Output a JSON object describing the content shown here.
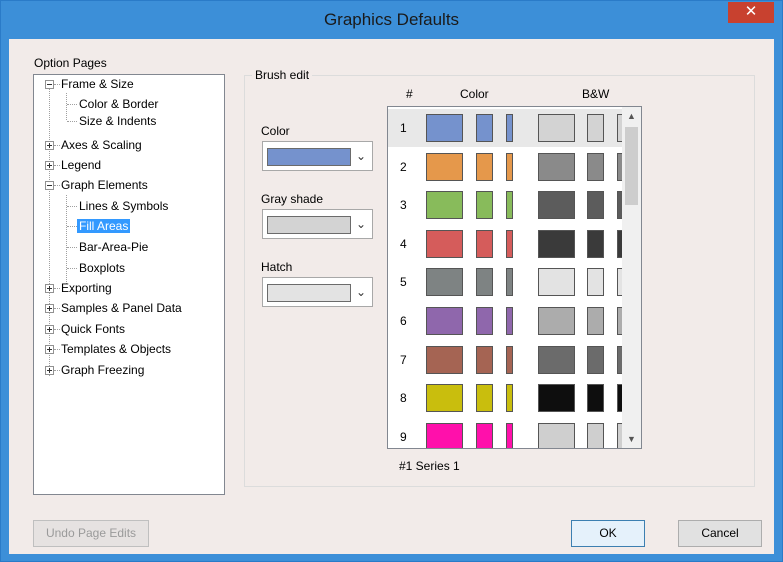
{
  "window": {
    "title": "Graphics Defaults",
    "close_glyph": "✕"
  },
  "option_pages": {
    "label": "Option Pages",
    "items": [
      {
        "label": "Frame & Size"
      },
      {
        "label": "Color & Border"
      },
      {
        "label": "Size & Indents"
      },
      {
        "label": "Axes & Scaling"
      },
      {
        "label": "Legend"
      },
      {
        "label": "Graph Elements"
      },
      {
        "label": "Lines & Symbols"
      },
      {
        "label": "Fill Areas",
        "selected": true
      },
      {
        "label": "Bar-Area-Pie"
      },
      {
        "label": "Boxplots"
      },
      {
        "label": "Exporting"
      },
      {
        "label": "Samples & Panel Data"
      },
      {
        "label": "Quick Fonts"
      },
      {
        "label": "Templates & Objects"
      },
      {
        "label": "Graph Freezing"
      }
    ]
  },
  "brush_edit": {
    "title": "Brush edit",
    "color_label": "Color",
    "color_value": "#7592cd",
    "gray_label": "Gray shade",
    "gray_value": "#d3d3d3",
    "hatch_label": "Hatch",
    "hatch_value": "#e3e3e3",
    "dropdown_glyph": "⌄"
  },
  "brush_list": {
    "col_num": "#",
    "col_color": "Color",
    "col_bw": "B&W",
    "rows": [
      {
        "num": "1",
        "color": "#7592cd",
        "gray": "#d3d3d3",
        "selected": true
      },
      {
        "num": "2",
        "color": "#e5984b",
        "gray": "#8a8a8a"
      },
      {
        "num": "3",
        "color": "#88bb5b",
        "gray": "#5c5c5c"
      },
      {
        "num": "4",
        "color": "#d55c5b",
        "gray": "#3a3a3a"
      },
      {
        "num": "5",
        "color": "#7e8383",
        "gray": "#e3e3e3"
      },
      {
        "num": "6",
        "color": "#8f67ac",
        "gray": "#acacac"
      },
      {
        "num": "7",
        "color": "#a56453",
        "gray": "#6b6b6b"
      },
      {
        "num": "8",
        "color": "#c9be0d",
        "gray": "#0e0e0e"
      },
      {
        "num": "9",
        "color": "#ff10ab",
        "gray": "#cfcfcf"
      }
    ],
    "scroll_up": "▲",
    "scroll_down": "▼"
  },
  "series_label": "#1 Series 1",
  "buttons": {
    "undo": "Undo Page Edits",
    "ok": "OK",
    "cancel": "Cancel"
  }
}
